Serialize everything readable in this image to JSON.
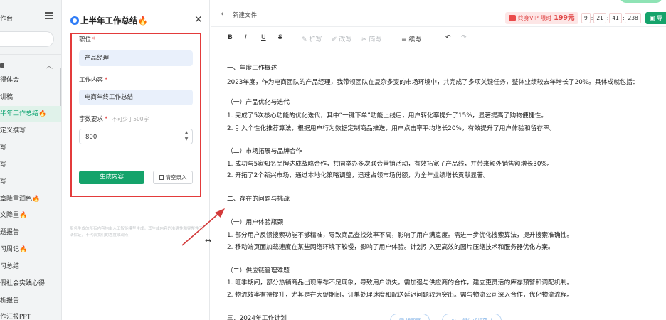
{
  "leftnav": {
    "workspace_title": "作台",
    "items": [
      {
        "label": "得体会",
        "active": false
      },
      {
        "label": "讲稿",
        "active": false
      },
      {
        "label": "半年工作总结",
        "active": true,
        "fire": "🔥"
      },
      {
        "label": "定义撰写",
        "active": false
      },
      {
        "label": "写",
        "active": false
      },
      {
        "label": "写",
        "active": false
      },
      {
        "label": "写",
        "active": false
      },
      {
        "label": "章降重润色",
        "active": false,
        "fire": "🔥"
      },
      {
        "label": "文降重",
        "active": false,
        "fire": "🔥"
      },
      {
        "label": "题报告",
        "active": false
      },
      {
        "label": "习周记",
        "active": false,
        "fire": "🔥"
      },
      {
        "label": "习总结",
        "active": false
      },
      {
        "label": "假社会实践心得",
        "active": false
      },
      {
        "label": "析报告",
        "active": false
      },
      {
        "label": "作汇报PPT",
        "active": false
      }
    ]
  },
  "form": {
    "title": "上半年工作总结",
    "title_fire": "🔥",
    "close": "✕",
    "position_label": "职位",
    "position_value": "产品经理",
    "content_label": "工作内容",
    "content_value": "电商年终工作总结",
    "wordcount_label": "字数要求",
    "wordcount_hint": "不可少于500字",
    "wordcount_value": "800",
    "required_mark": "*",
    "generate_button": "生成内容",
    "clear_button": "清空录入",
    "disclaimer": "服务生成的所有内容均由人工智能模型生成，其生成内容的准确性和完整性无法保证，不代表我们的态度或观点"
  },
  "editor": {
    "doc_name": "新建文件",
    "vip_text": "终身VIP 限时",
    "vip_price": "199元",
    "timer": [
      "9",
      "21",
      "41",
      "238"
    ],
    "save_label": "导",
    "toolbar": {
      "bold": "B",
      "italic": "I",
      "underline": "U",
      "strike": "S",
      "expand": "扩写",
      "rewrite": "改写",
      "simplify": "简写",
      "continue": "续写",
      "undo": "↶",
      "redo": "↷"
    },
    "lines": [
      "一、年度工作概述",
      "2023年度，作为电商团队的产品经理，我带领团队在复杂多变的市场环境中，共完成了多项关键任务，整体业绩较去年增长了20%。具体成就包括：",
      "（一）产品优化与迭代",
      "1. 完成了5次核心功能的优化迭代，其中“一键下单”功能上线后，用户转化率提升了15%，显著提高了购物便捷性。",
      "2. 引入个性化推荐算法，根据用户行为数据定制商品推送，用户点击率平均增长20%，有效提升了用户体验和留存率。",
      "（二）市场拓展与品牌合作",
      "1. 成功与5家知名品牌达成战略合作，共同举办多次联合营销活动，有效拓宽了产品线，并带来额外销售额增长30%。",
      "2. 开拓了2个新兴市场，通过本地化策略调整，迅速占领市场份额，为全年业绩增长贡献显著。",
      "二、存在的问题与挑战",
      "（一）用户体验瓶颈",
      "1. 部分用户反馈搜索功能不够精准，导致商品查找效率不高，影响了用户满意度。需进一步优化搜索算法，提升搜索准确性。",
      "2. 移动端页面加载速度在某些网络环境下较慢，影响了用户体验。计划引入更高效的图片压缩技术和服务器优化方案。",
      "（二）供应链管理难题",
      "1. 旺季期间，部分热销商品出现库存不足现象，导致用户流失。需加强与供应商的合作，建立更灵活的库存预警和调配机制。",
      "2. 物流效率有待提升，尤其是在大促期间，订单处理速度和配送延迟问题较为突出。需与物流公司深入合作，优化物流流程。",
      "三、2024年工作计划"
    ],
    "float_buttons": [
      "图 插图页",
      "AI 一键生成规范书"
    ]
  }
}
